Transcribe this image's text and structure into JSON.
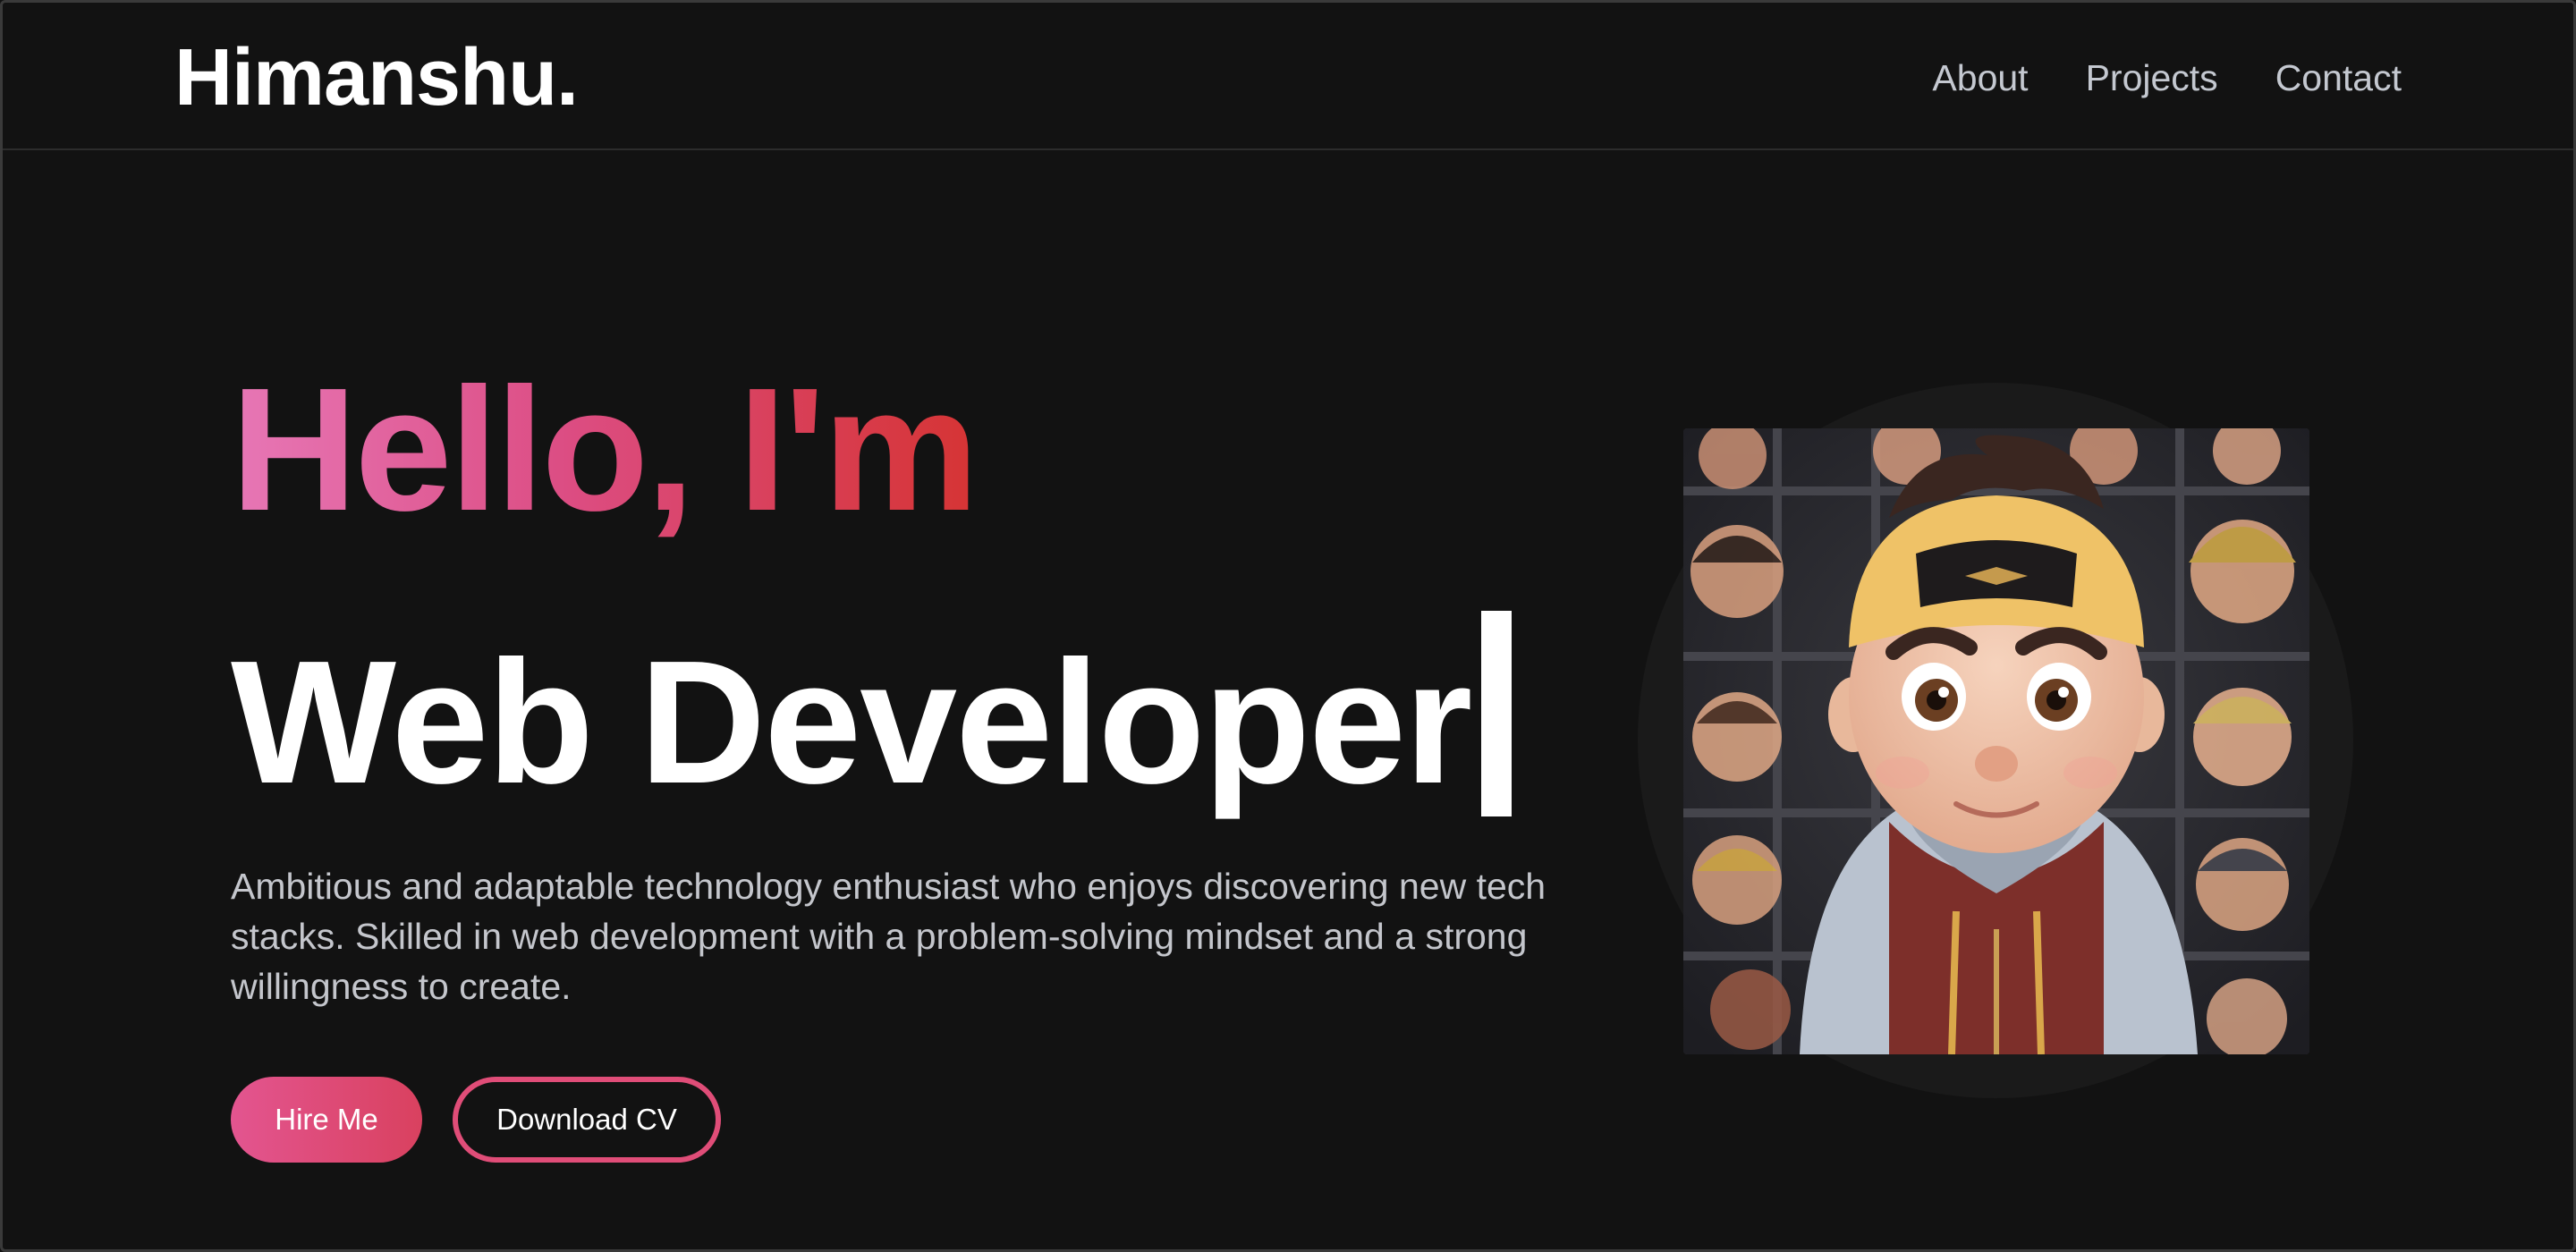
{
  "nav": {
    "brand": "Himanshu.",
    "links": [
      "About",
      "Projects",
      "Contact"
    ]
  },
  "hero": {
    "greeting": "Hello, I'm",
    "role": "Web Developer",
    "description": "Ambitious and adaptable technology enthusiast who enjoys discovering new tech stacks. Skilled in web development with a problem-solving mindset and a strong willingness to create.",
    "buttons": {
      "hire": "Hire Me",
      "download_cv": "Download CV"
    },
    "avatar_icon": "cartoon-avatar"
  },
  "colors": {
    "background": "#121212",
    "accent_pink": "#e35590",
    "accent_red": "#d63434",
    "text_muted": "#c4c6cc"
  }
}
